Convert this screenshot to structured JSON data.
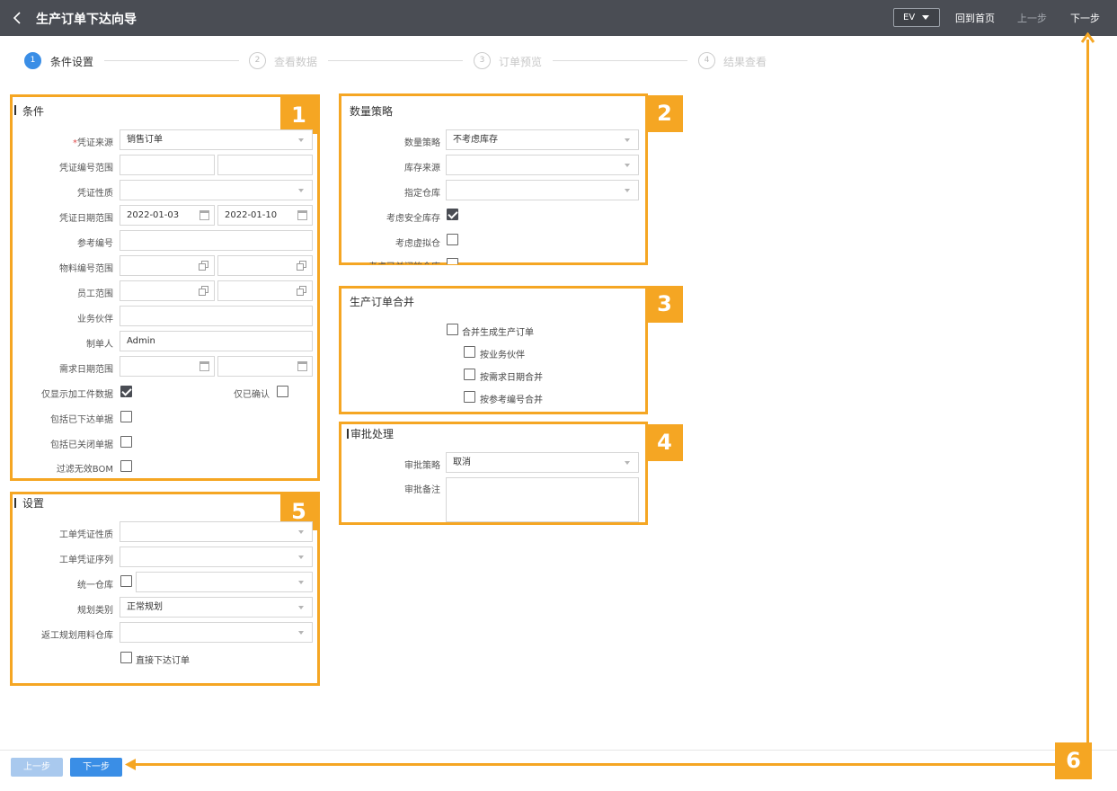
{
  "header": {
    "title": "生产订单下达向导",
    "lang": "EV",
    "home": "回到首页",
    "prev": "上一步",
    "next": "下一步"
  },
  "steps": [
    {
      "num": "1",
      "label": "条件设置",
      "active": true
    },
    {
      "num": "2",
      "label": "查看数据",
      "active": false
    },
    {
      "num": "3",
      "label": "订单预览",
      "active": false
    },
    {
      "num": "4",
      "label": "结果查看",
      "active": false
    }
  ],
  "badges": [
    "1",
    "2",
    "3",
    "4",
    "5",
    "6"
  ],
  "conditions": {
    "title": "条件",
    "source_label": "凭证来源",
    "source_value": "销售订单",
    "doc_no_label": "凭证编号范围",
    "doc_nature_label": "凭证性质",
    "doc_date_label": "凭证日期范围",
    "date_from": "2022-01-03",
    "date_to": "2022-01-10",
    "ref_no_label": "参考编号",
    "item_label": "物料编号范围",
    "employee_label": "员工范围",
    "partner_label": "业务伙伴",
    "creator_label": "制单人",
    "creator_value": "Admin",
    "req_date_label": "需求日期范围",
    "only_extra_label": "仅显示加工件数据",
    "only_extra_checked": true,
    "only_confirmed_label": "仅已确认",
    "only_confirmed_checked": false,
    "include_released_label": "包括已下达单据",
    "include_closed_label": "包括已关闭单据",
    "filter_bom_label": "过滤无效BOM"
  },
  "quantity": {
    "title": "数量策略",
    "strategy_label": "数量策略",
    "strategy_value": "不考虑库存",
    "stock_source_label": "库存来源",
    "warehouse_label": "指定仓库",
    "safety_label": "考虑安全库存",
    "safety_checked": true,
    "virtual_label": "考虑虚拟仓",
    "virtual_checked": false,
    "closed_wh_label": "考虑已关闭的仓库",
    "closed_wh_checked": false
  },
  "merge": {
    "title": "生产订单合并",
    "merge_label": "合并生成生产订单",
    "by_partner_label": "按业务伙伴",
    "by_date_label": "按需求日期合并",
    "by_ref_label": "按参考编号合并"
  },
  "approval": {
    "title": "审批处理",
    "strategy_label": "审批策略",
    "strategy_value": "取消",
    "remark_label": "审批备注"
  },
  "settings": {
    "title": "设置",
    "wo_nature_label": "工单凭证性质",
    "wo_series_label": "工单凭证序列",
    "unified_wh_label": "统一仓库",
    "plan_type_label": "规划类别",
    "plan_type_value": "正常规划",
    "rework_wh_label": "返工规划用料仓库",
    "direct_release_label": "直接下达订单"
  },
  "footer": {
    "prev": "上一步",
    "next": "下一步"
  },
  "colors": {
    "highlight": "#f5a623",
    "primary": "#3a8ee6",
    "header": "#4a4d54"
  }
}
